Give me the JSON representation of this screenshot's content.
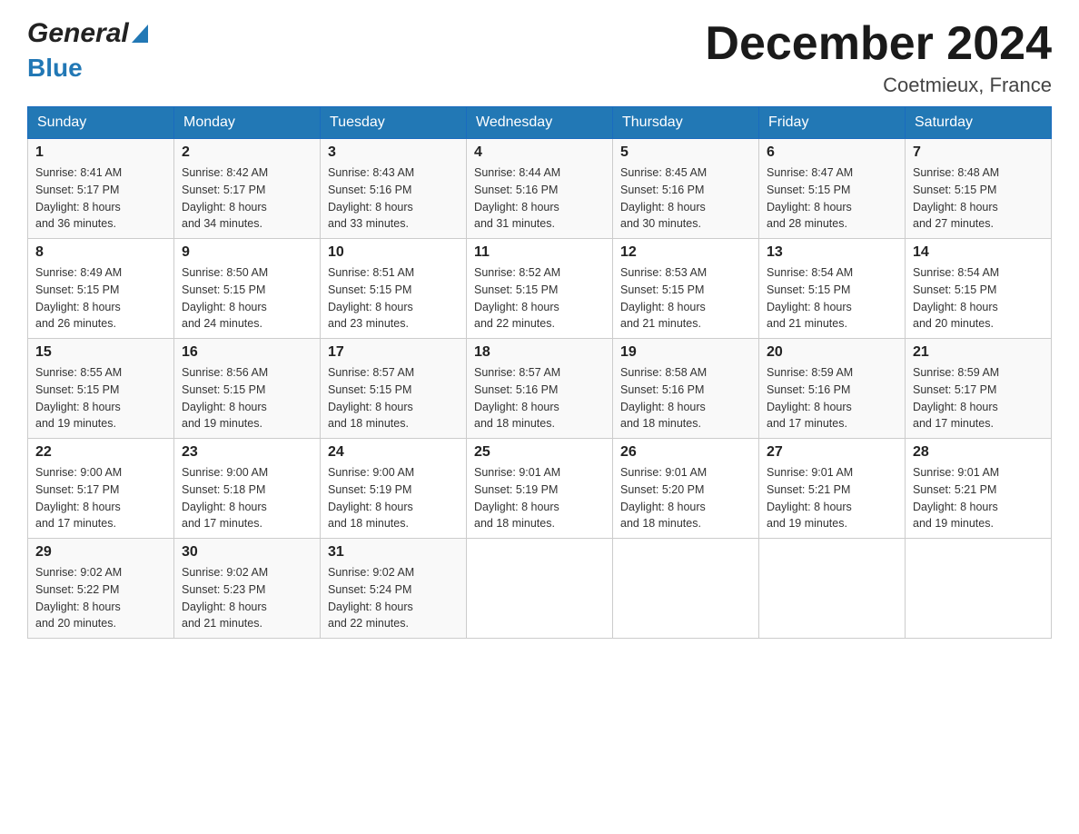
{
  "header": {
    "logo_general": "General",
    "logo_blue": "Blue",
    "month_title": "December 2024",
    "location": "Coetmieux, France"
  },
  "calendar": {
    "days_of_week": [
      "Sunday",
      "Monday",
      "Tuesday",
      "Wednesday",
      "Thursday",
      "Friday",
      "Saturday"
    ],
    "weeks": [
      [
        {
          "day": "1",
          "sunrise": "8:41 AM",
          "sunset": "5:17 PM",
          "daylight": "8 hours and 36 minutes."
        },
        {
          "day": "2",
          "sunrise": "8:42 AM",
          "sunset": "5:17 PM",
          "daylight": "8 hours and 34 minutes."
        },
        {
          "day": "3",
          "sunrise": "8:43 AM",
          "sunset": "5:16 PM",
          "daylight": "8 hours and 33 minutes."
        },
        {
          "day": "4",
          "sunrise": "8:44 AM",
          "sunset": "5:16 PM",
          "daylight": "8 hours and 31 minutes."
        },
        {
          "day": "5",
          "sunrise": "8:45 AM",
          "sunset": "5:16 PM",
          "daylight": "8 hours and 30 minutes."
        },
        {
          "day": "6",
          "sunrise": "8:47 AM",
          "sunset": "5:15 PM",
          "daylight": "8 hours and 28 minutes."
        },
        {
          "day": "7",
          "sunrise": "8:48 AM",
          "sunset": "5:15 PM",
          "daylight": "8 hours and 27 minutes."
        }
      ],
      [
        {
          "day": "8",
          "sunrise": "8:49 AM",
          "sunset": "5:15 PM",
          "daylight": "8 hours and 26 minutes."
        },
        {
          "day": "9",
          "sunrise": "8:50 AM",
          "sunset": "5:15 PM",
          "daylight": "8 hours and 24 minutes."
        },
        {
          "day": "10",
          "sunrise": "8:51 AM",
          "sunset": "5:15 PM",
          "daylight": "8 hours and 23 minutes."
        },
        {
          "day": "11",
          "sunrise": "8:52 AM",
          "sunset": "5:15 PM",
          "daylight": "8 hours and 22 minutes."
        },
        {
          "day": "12",
          "sunrise": "8:53 AM",
          "sunset": "5:15 PM",
          "daylight": "8 hours and 21 minutes."
        },
        {
          "day": "13",
          "sunrise": "8:54 AM",
          "sunset": "5:15 PM",
          "daylight": "8 hours and 21 minutes."
        },
        {
          "day": "14",
          "sunrise": "8:54 AM",
          "sunset": "5:15 PM",
          "daylight": "8 hours and 20 minutes."
        }
      ],
      [
        {
          "day": "15",
          "sunrise": "8:55 AM",
          "sunset": "5:15 PM",
          "daylight": "8 hours and 19 minutes."
        },
        {
          "day": "16",
          "sunrise": "8:56 AM",
          "sunset": "5:15 PM",
          "daylight": "8 hours and 19 minutes."
        },
        {
          "day": "17",
          "sunrise": "8:57 AM",
          "sunset": "5:15 PM",
          "daylight": "8 hours and 18 minutes."
        },
        {
          "day": "18",
          "sunrise": "8:57 AM",
          "sunset": "5:16 PM",
          "daylight": "8 hours and 18 minutes."
        },
        {
          "day": "19",
          "sunrise": "8:58 AM",
          "sunset": "5:16 PM",
          "daylight": "8 hours and 18 minutes."
        },
        {
          "day": "20",
          "sunrise": "8:59 AM",
          "sunset": "5:16 PM",
          "daylight": "8 hours and 17 minutes."
        },
        {
          "day": "21",
          "sunrise": "8:59 AM",
          "sunset": "5:17 PM",
          "daylight": "8 hours and 17 minutes."
        }
      ],
      [
        {
          "day": "22",
          "sunrise": "9:00 AM",
          "sunset": "5:17 PM",
          "daylight": "8 hours and 17 minutes."
        },
        {
          "day": "23",
          "sunrise": "9:00 AM",
          "sunset": "5:18 PM",
          "daylight": "8 hours and 17 minutes."
        },
        {
          "day": "24",
          "sunrise": "9:00 AM",
          "sunset": "5:19 PM",
          "daylight": "8 hours and 18 minutes."
        },
        {
          "day": "25",
          "sunrise": "9:01 AM",
          "sunset": "5:19 PM",
          "daylight": "8 hours and 18 minutes."
        },
        {
          "day": "26",
          "sunrise": "9:01 AM",
          "sunset": "5:20 PM",
          "daylight": "8 hours and 18 minutes."
        },
        {
          "day": "27",
          "sunrise": "9:01 AM",
          "sunset": "5:21 PM",
          "daylight": "8 hours and 19 minutes."
        },
        {
          "day": "28",
          "sunrise": "9:01 AM",
          "sunset": "5:21 PM",
          "daylight": "8 hours and 19 minutes."
        }
      ],
      [
        {
          "day": "29",
          "sunrise": "9:02 AM",
          "sunset": "5:22 PM",
          "daylight": "8 hours and 20 minutes."
        },
        {
          "day": "30",
          "sunrise": "9:02 AM",
          "sunset": "5:23 PM",
          "daylight": "8 hours and 21 minutes."
        },
        {
          "day": "31",
          "sunrise": "9:02 AM",
          "sunset": "5:24 PM",
          "daylight": "8 hours and 22 minutes."
        },
        null,
        null,
        null,
        null
      ]
    ],
    "labels": {
      "sunrise": "Sunrise:",
      "sunset": "Sunset:",
      "daylight": "Daylight:"
    }
  }
}
